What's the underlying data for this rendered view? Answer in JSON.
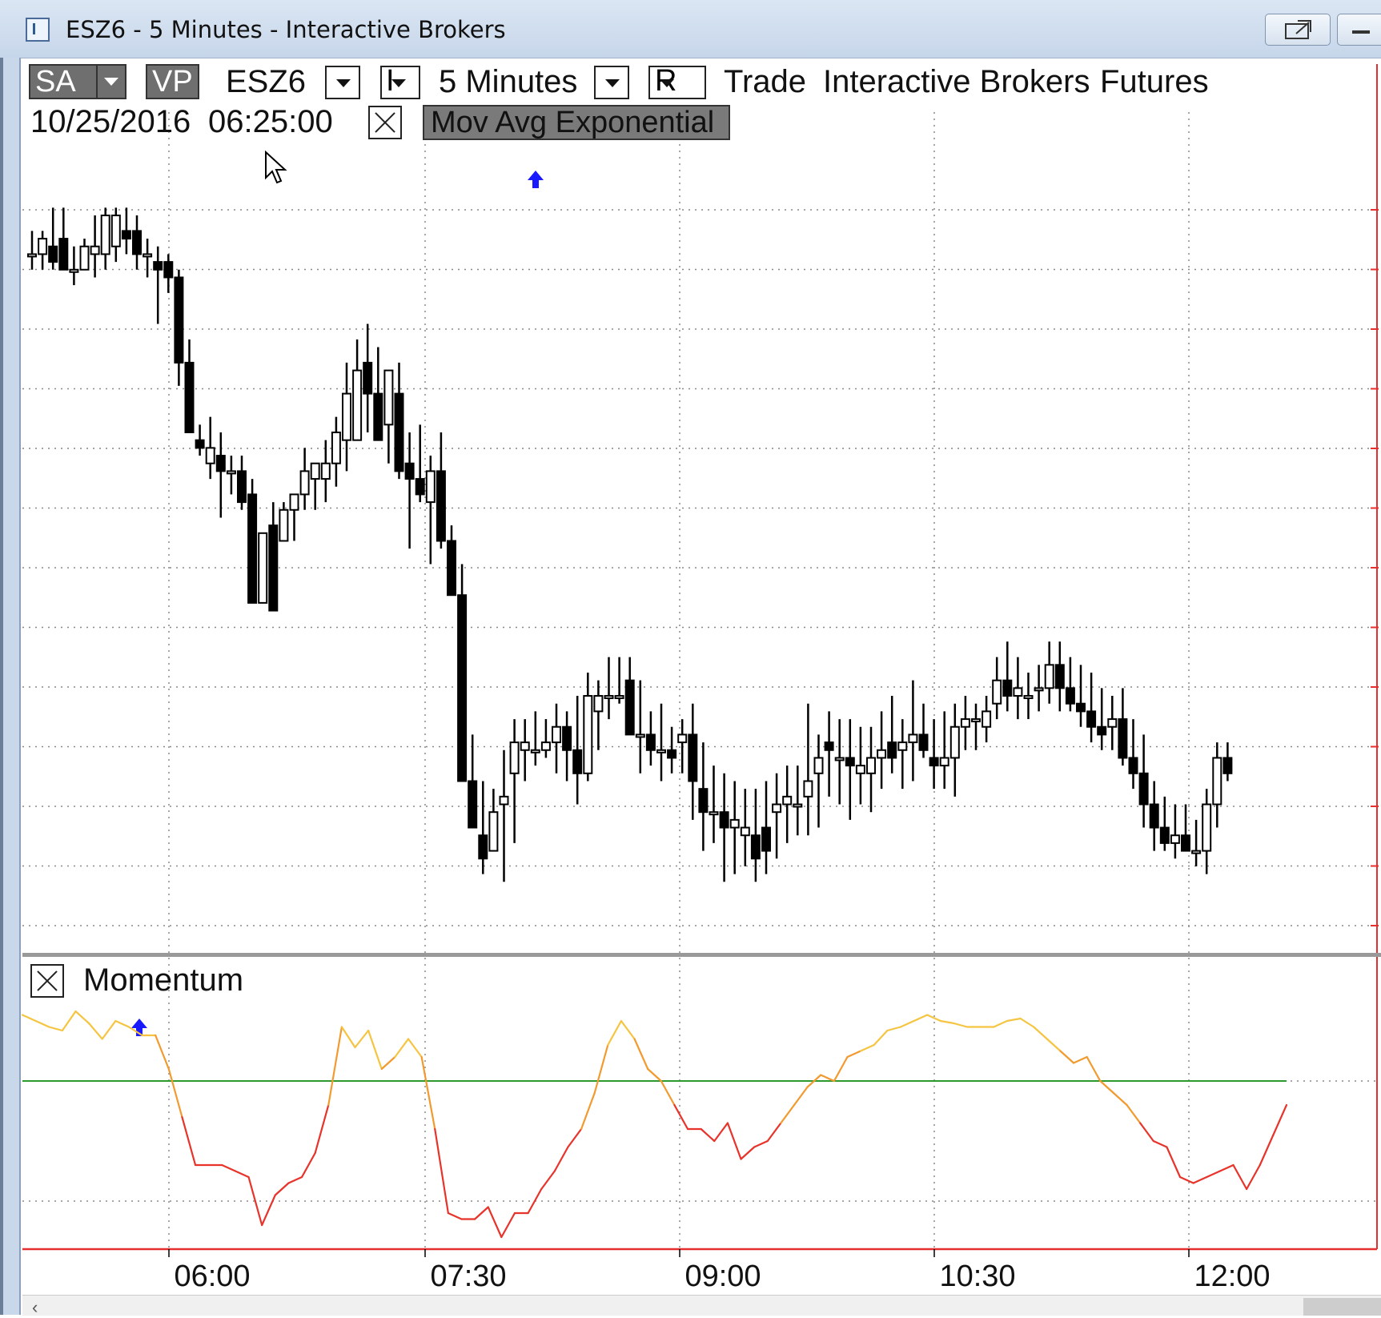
{
  "window": {
    "title": "ESZ6 - 5 Minutes - Interactive Brokers",
    "icon": "chart-document-icon",
    "buttons": [
      "popout-icon",
      "minimize-icon"
    ]
  },
  "toolbar": {
    "sa": "SA",
    "vp": "VP",
    "symbol": "ESZ6",
    "interval_prefix": "I",
    "interval": "5 Minutes",
    "range": "R",
    "data_type": "Trade",
    "broker": "Interactive Brokers",
    "instrument_class": "Futures"
  },
  "cursor_readout": {
    "date": "10/25/2016",
    "time": "06:25:00"
  },
  "price_pane": {
    "indicator": "Mov Avg Exponential"
  },
  "momentum_pane": {
    "title": "Momentum",
    "line_colors": [
      "#f5c542",
      "#f29a2e",
      "#e8332a"
    ],
    "zero_line_color": "#2e9a2e"
  },
  "colors": {
    "up_candle": "#ffffff",
    "down_candle": "#000000",
    "signal_arrow": "#1a1aff",
    "scale_line": "#e53030"
  },
  "chart_data": {
    "type": "candlestick",
    "x_ticks": [
      "06:00",
      "07:30",
      "09:00",
      "10:30",
      "12:00"
    ],
    "bar_interval_minutes": 5,
    "ohlc": [
      [
        9.0,
        9.3,
        8.8,
        9.0
      ],
      [
        9.0,
        9.3,
        8.8,
        9.2
      ],
      [
        9.1,
        9.6,
        8.8,
        8.9
      ],
      [
        9.2,
        9.6,
        8.8,
        8.8
      ],
      [
        8.8,
        9.1,
        8.6,
        8.8
      ],
      [
        8.8,
        9.2,
        8.8,
        9.1
      ],
      [
        9.0,
        9.5,
        8.7,
        9.1
      ],
      [
        9.0,
        9.6,
        8.8,
        9.5
      ],
      [
        9.1,
        9.6,
        8.9,
        9.5
      ],
      [
        9.3,
        9.6,
        9.0,
        9.2
      ],
      [
        9.3,
        9.5,
        8.8,
        9.0
      ],
      [
        9.0,
        9.2,
        8.7,
        9.0
      ],
      [
        8.9,
        9.1,
        8.1,
        8.8
      ],
      [
        8.9,
        9.0,
        8.5,
        8.7
      ],
      [
        8.7,
        8.8,
        7.3,
        7.6
      ],
      [
        7.6,
        7.9,
        7.1,
        6.7
      ],
      [
        6.6,
        6.8,
        6.4,
        6.5
      ],
      [
        6.3,
        6.9,
        6.1,
        6.5
      ],
      [
        6.4,
        6.7,
        5.6,
        6.2
      ],
      [
        6.2,
        6.4,
        5.9,
        6.2
      ],
      [
        6.2,
        6.4,
        5.7,
        5.8
      ],
      [
        5.9,
        6.1,
        5.2,
        4.5
      ],
      [
        4.5,
        5.4,
        5.5,
        5.4
      ],
      [
        5.5,
        5.8,
        4.4,
        4.4
      ],
      [
        5.3,
        5.8,
        5.3,
        5.7
      ],
      [
        5.7,
        5.9,
        5.3,
        5.9
      ],
      [
        5.9,
        6.5,
        5.7,
        6.2
      ],
      [
        6.1,
        6.3,
        5.7,
        6.3
      ],
      [
        6.1,
        6.6,
        5.8,
        6.3
      ],
      [
        6.3,
        6.9,
        6.0,
        6.7
      ],
      [
        6.6,
        7.6,
        6.2,
        7.2
      ],
      [
        6.6,
        7.9,
        6.6,
        7.5
      ],
      [
        7.6,
        8.1,
        6.7,
        7.2
      ],
      [
        7.2,
        7.8,
        6.9,
        6.6
      ],
      [
        6.8,
        7.5,
        6.3,
        7.5
      ],
      [
        7.2,
        7.6,
        6.1,
        6.2
      ],
      [
        6.3,
        6.7,
        5.2,
        6.1
      ],
      [
        6.1,
        6.8,
        5.8,
        5.9
      ],
      [
        5.8,
        6.4,
        5.0,
        6.2
      ],
      [
        6.2,
        6.7,
        5.2,
        5.3
      ],
      [
        5.3,
        5.5,
        4.8,
        4.6
      ],
      [
        4.6,
        5.0,
        2.6,
        2.2
      ],
      [
        2.2,
        2.8,
        1.6,
        1.6
      ],
      [
        1.5,
        2.2,
        1.0,
        1.2
      ],
      [
        1.3,
        2.1,
        1.3,
        1.8
      ],
      [
        1.9,
        2.6,
        0.9,
        2.0
      ],
      [
        2.3,
        3.0,
        1.4,
        2.7
      ],
      [
        2.6,
        3.0,
        2.2,
        2.7
      ],
      [
        2.6,
        3.1,
        2.4,
        2.6
      ],
      [
        2.6,
        3.0,
        2.5,
        2.7
      ],
      [
        2.7,
        3.2,
        2.3,
        2.9
      ],
      [
        2.9,
        3.1,
        2.2,
        2.6
      ],
      [
        2.6,
        3.3,
        1.9,
        2.3
      ],
      [
        2.3,
        3.6,
        2.2,
        3.3
      ],
      [
        3.1,
        3.5,
        2.6,
        3.3
      ],
      [
        3.3,
        3.8,
        3.0,
        3.3
      ],
      [
        3.3,
        3.8,
        3.2,
        3.3
      ],
      [
        3.5,
        3.8,
        3.3,
        2.8
      ],
      [
        2.8,
        3.5,
        2.3,
        2.8
      ],
      [
        2.8,
        3.1,
        2.4,
        2.6
      ],
      [
        2.6,
        3.2,
        2.2,
        2.6
      ],
      [
        2.6,
        2.9,
        2.3,
        2.5
      ],
      [
        2.7,
        3.0,
        2.3,
        2.8
      ],
      [
        2.8,
        3.2,
        1.7,
        2.2
      ],
      [
        2.1,
        2.7,
        1.3,
        1.8
      ],
      [
        1.8,
        2.4,
        1.4,
        1.8
      ],
      [
        1.8,
        2.3,
        0.9,
        1.6
      ],
      [
        1.6,
        2.2,
        1.0,
        1.7
      ],
      [
        1.5,
        2.1,
        1.1,
        1.6
      ],
      [
        1.5,
        2.1,
        0.9,
        1.2
      ],
      [
        1.6,
        2.2,
        1.0,
        1.3
      ],
      [
        1.8,
        2.3,
        1.2,
        1.9
      ],
      [
        1.9,
        2.4,
        1.4,
        2.0
      ],
      [
        1.9,
        2.4,
        1.5,
        1.9
      ],
      [
        2.0,
        3.2,
        1.5,
        2.2
      ],
      [
        2.3,
        2.8,
        1.6,
        2.5
      ],
      [
        2.7,
        3.1,
        2.0,
        2.6
      ],
      [
        2.5,
        3.0,
        1.9,
        2.5
      ],
      [
        2.5,
        3.0,
        1.7,
        2.4
      ],
      [
        2.3,
        2.9,
        1.9,
        2.4
      ],
      [
        2.3,
        2.9,
        1.8,
        2.5
      ],
      [
        2.5,
        3.1,
        2.1,
        2.6
      ],
      [
        2.7,
        3.3,
        2.3,
        2.5
      ],
      [
        2.6,
        3.0,
        2.1,
        2.7
      ],
      [
        2.7,
        3.5,
        2.2,
        2.8
      ],
      [
        2.8,
        3.2,
        2.5,
        2.6
      ],
      [
        2.5,
        3.0,
        2.1,
        2.4
      ],
      [
        2.4,
        3.1,
        2.1,
        2.5
      ],
      [
        2.5,
        3.2,
        2.0,
        2.9
      ],
      [
        2.9,
        3.3,
        2.6,
        3.0
      ],
      [
        3.0,
        3.2,
        2.6,
        3.0
      ],
      [
        2.9,
        3.3,
        2.7,
        3.1
      ],
      [
        3.2,
        3.8,
        3.0,
        3.5
      ],
      [
        3.5,
        4.0,
        3.1,
        3.3
      ],
      [
        3.3,
        3.8,
        3.0,
        3.4
      ],
      [
        3.3,
        3.6,
        3.0,
        3.3
      ],
      [
        3.4,
        3.7,
        3.1,
        3.4
      ],
      [
        3.4,
        4.0,
        3.2,
        3.7
      ],
      [
        3.7,
        4.0,
        3.1,
        3.4
      ],
      [
        3.4,
        3.8,
        3.1,
        3.2
      ],
      [
        3.2,
        3.7,
        2.9,
        3.1
      ],
      [
        3.1,
        3.6,
        2.7,
        2.9
      ],
      [
        2.9,
        3.4,
        2.6,
        2.8
      ],
      [
        2.9,
        3.3,
        2.6,
        3.0
      ],
      [
        3.0,
        3.4,
        2.4,
        2.5
      ],
      [
        2.5,
        3.0,
        2.1,
        2.3
      ],
      [
        2.3,
        2.8,
        1.6,
        1.9
      ],
      [
        1.9,
        2.2,
        1.3,
        1.6
      ],
      [
        1.6,
        2.0,
        1.3,
        1.4
      ],
      [
        1.4,
        1.9,
        1.2,
        1.5
      ],
      [
        1.5,
        1.9,
        1.3,
        1.3
      ],
      [
        1.3,
        1.7,
        1.1,
        1.3
      ],
      [
        1.3,
        2.1,
        1.0,
        1.9
      ],
      [
        1.9,
        2.7,
        1.6,
        2.5
      ],
      [
        2.5,
        2.7,
        2.2,
        2.3
      ]
    ],
    "momentum": [
      0.55,
      0.5,
      0.45,
      0.42,
      0.58,
      0.48,
      0.35,
      0.5,
      0.45,
      0.38,
      0.38,
      0.1,
      -0.3,
      -0.7,
      -0.7,
      -0.7,
      -0.75,
      -0.8,
      -1.2,
      -0.95,
      -0.85,
      -0.8,
      -0.6,
      -0.2,
      0.45,
      0.28,
      0.42,
      0.1,
      0.2,
      0.35,
      0.2,
      -0.4,
      -1.1,
      -1.15,
      -1.15,
      -1.05,
      -1.3,
      -1.1,
      -1.1,
      -0.9,
      -0.75,
      -0.55,
      -0.4,
      -0.1,
      0.3,
      0.5,
      0.35,
      0.1,
      0.0,
      -0.2,
      -0.4,
      -0.4,
      -0.5,
      -0.35,
      -0.65,
      -0.55,
      -0.5,
      -0.35,
      -0.2,
      -0.05,
      0.05,
      0.0,
      0.2,
      0.25,
      0.3,
      0.42,
      0.45,
      0.5,
      0.55,
      0.5,
      0.48,
      0.45,
      0.45,
      0.45,
      0.5,
      0.52,
      0.45,
      0.35,
      0.25,
      0.15,
      0.2,
      0.0,
      -0.1,
      -0.2,
      -0.35,
      -0.5,
      -0.55,
      -0.8,
      -0.85,
      -0.8,
      -0.75,
      -0.7,
      -0.9,
      -0.7,
      -0.45,
      -0.2
    ]
  }
}
